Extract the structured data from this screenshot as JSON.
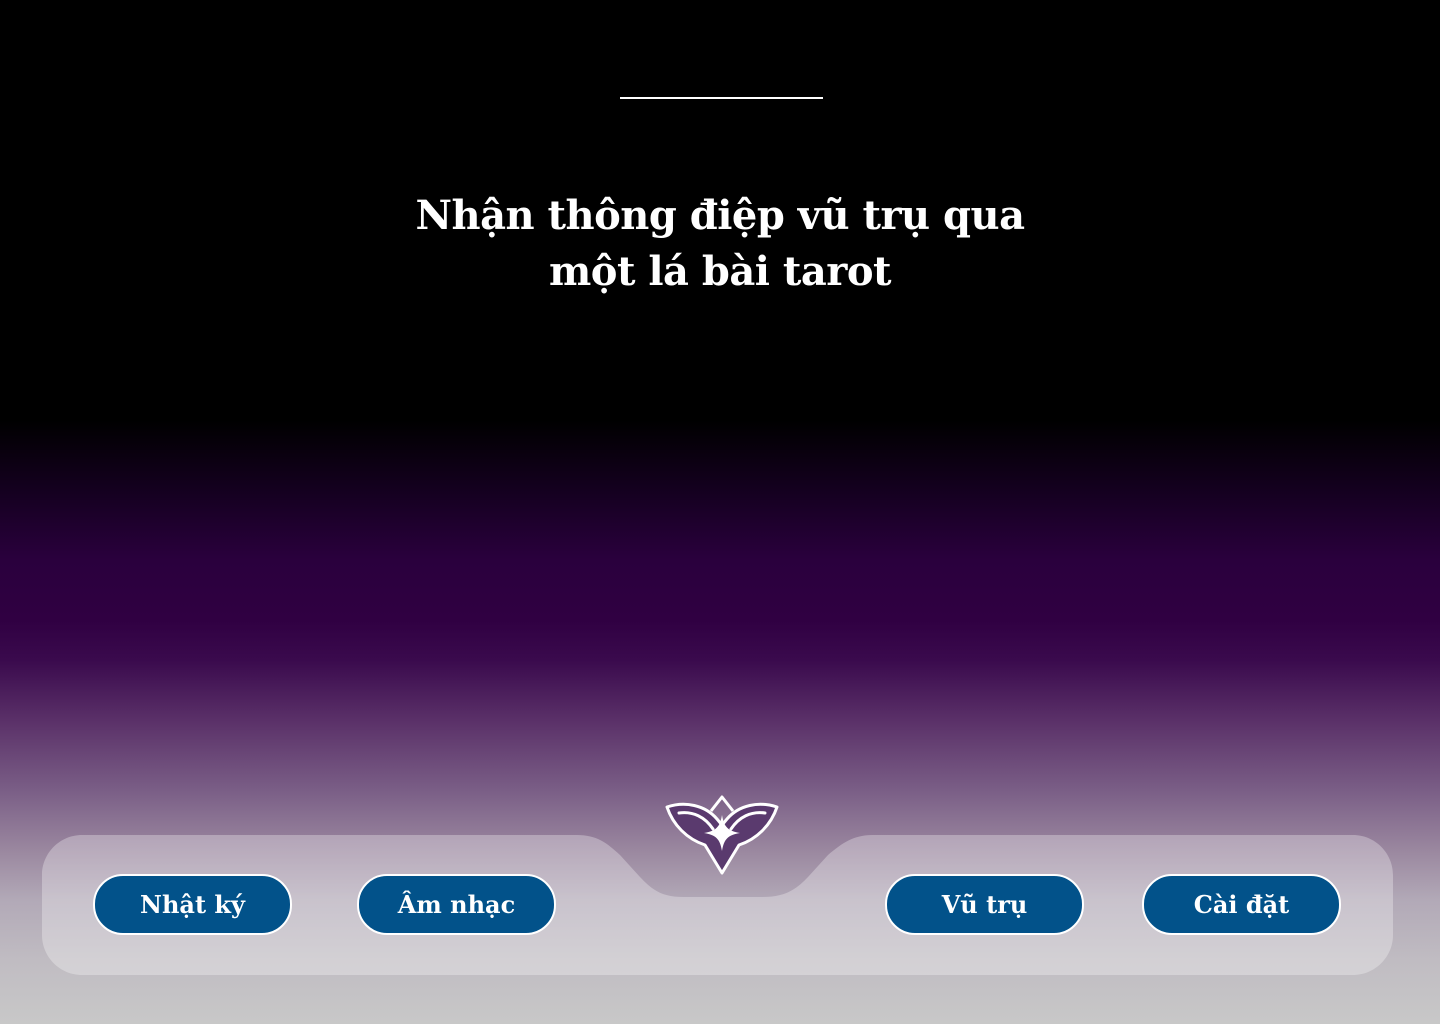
{
  "header": {
    "headline_line1": "Nhận thông điệp vũ trụ qua",
    "headline_line2": "một lá bài tarot"
  },
  "nav": {
    "journal_label": "Nhật ký",
    "music_label": "Âm nhạc",
    "universe_label": "Vũ trụ",
    "settings_label": "Cài đặt",
    "center_icon": "lotus-star-icon"
  },
  "colors": {
    "button_fill": "#02528a",
    "button_border": "#ffffff",
    "nav_panel": "#ffffff",
    "gradient_top": "#000000",
    "gradient_mid": "#300042",
    "gradient_bottom": "#c8c8c8"
  }
}
